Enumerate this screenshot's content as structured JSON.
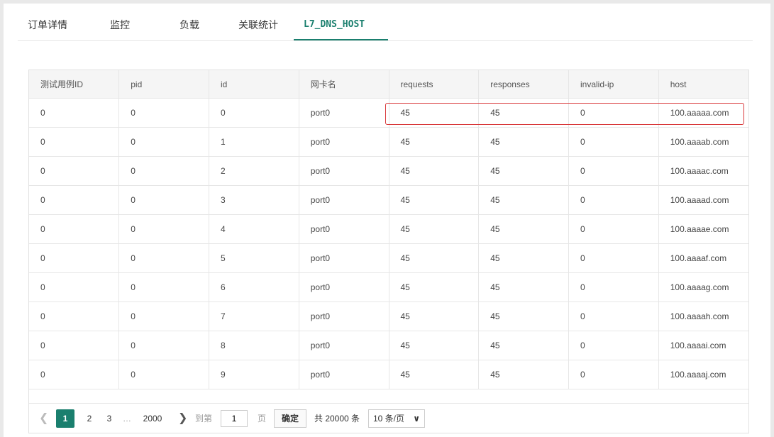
{
  "tabs": [
    {
      "label": "订单详情"
    },
    {
      "label": "监控"
    },
    {
      "label": "负载"
    },
    {
      "label": "关联统计"
    },
    {
      "label": "L7_DNS_HOST",
      "active": true
    }
  ],
  "table": {
    "columns": [
      "测试用例ID",
      "pid",
      "id",
      "网卡名",
      "requests",
      "responses",
      "invalid-ip",
      "host"
    ],
    "rows": [
      [
        "0",
        "0",
        "0",
        "port0",
        "45",
        "45",
        "0",
        "100.aaaaa.com"
      ],
      [
        "0",
        "0",
        "1",
        "port0",
        "45",
        "45",
        "0",
        "100.aaaab.com"
      ],
      [
        "0",
        "0",
        "2",
        "port0",
        "45",
        "45",
        "0",
        "100.aaaac.com"
      ],
      [
        "0",
        "0",
        "3",
        "port0",
        "45",
        "45",
        "0",
        "100.aaaad.com"
      ],
      [
        "0",
        "0",
        "4",
        "port0",
        "45",
        "45",
        "0",
        "100.aaaae.com"
      ],
      [
        "0",
        "0",
        "5",
        "port0",
        "45",
        "45",
        "0",
        "100.aaaaf.com"
      ],
      [
        "0",
        "0",
        "6",
        "port0",
        "45",
        "45",
        "0",
        "100.aaaag.com"
      ],
      [
        "0",
        "0",
        "7",
        "port0",
        "45",
        "45",
        "0",
        "100.aaaah.com"
      ],
      [
        "0",
        "0",
        "8",
        "port0",
        "45",
        "45",
        "0",
        "100.aaaai.com"
      ],
      [
        "0",
        "0",
        "9",
        "port0",
        "45",
        "45",
        "0",
        "100.aaaaj.com"
      ]
    ]
  },
  "pager": {
    "prev_icon": "chevron-left-icon",
    "pages": [
      "1",
      "2",
      "3"
    ],
    "ellipsis": "…",
    "last_page": "2000",
    "next_icon": "chevron-right-icon",
    "goto_label": "到第",
    "goto_value": "1",
    "page_unit": "页",
    "confirm_label": "确定",
    "total_text": "共 20000 条",
    "page_size": "10 条/页"
  },
  "colors": {
    "accent": "#1a7f6e",
    "highlight": "#d9383a"
  }
}
